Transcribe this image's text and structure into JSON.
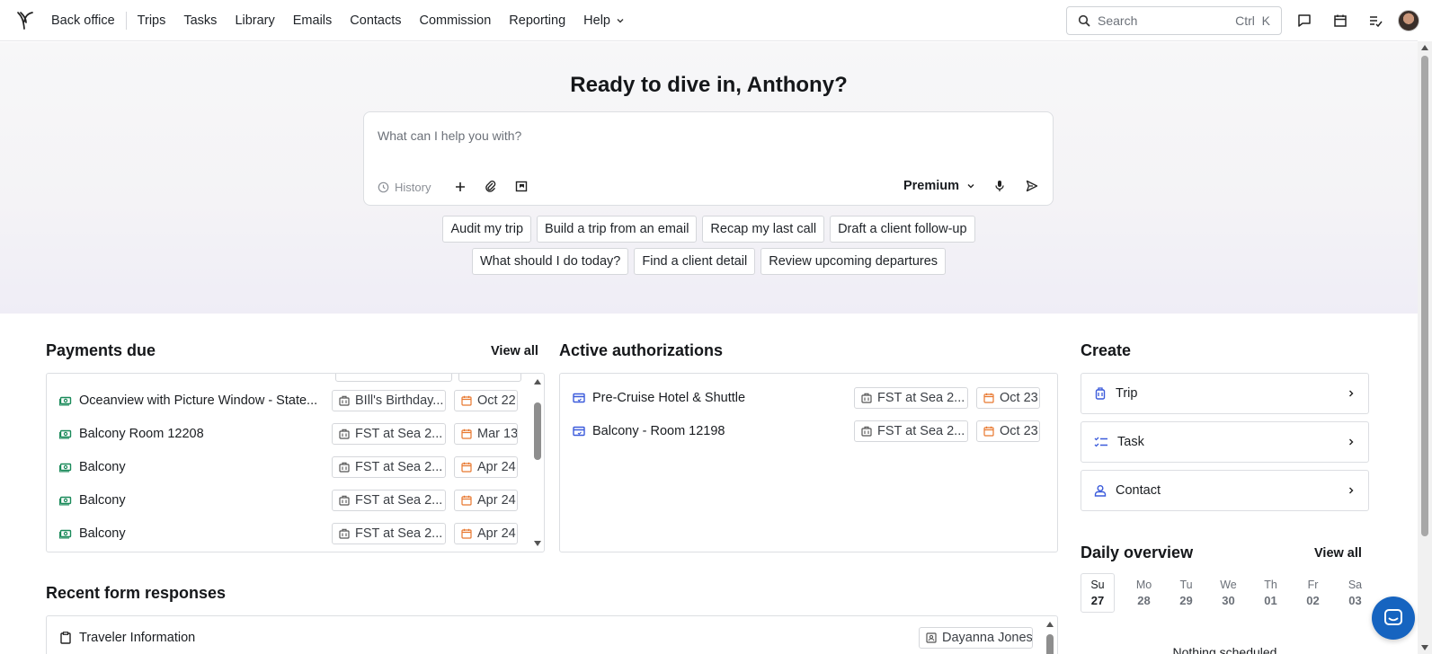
{
  "nav": {
    "items": [
      "Back office",
      "Trips",
      "Tasks",
      "Library",
      "Emails",
      "Contacts",
      "Commission",
      "Reporting",
      "Help"
    ],
    "search_placeholder": "Search",
    "search_shortcut": "Ctrl  K"
  },
  "hero": {
    "title": "Ready to dive in, Anthony?",
    "prompt_placeholder": "What can I help you with?",
    "history_label": "History",
    "model_label": "Premium",
    "chips_row1": [
      "Audit my trip",
      "Build a trip from an email",
      "Recap my last call",
      "Draft a client follow-up"
    ],
    "chips_row2": [
      "What should I do today?",
      "Find a client detail",
      "Review upcoming departures"
    ]
  },
  "payments": {
    "title": "Payments due",
    "view_all": "View all",
    "rows": [
      {
        "label": "Oceanview with Picture Window - State...",
        "trip": "BIll's Birthday...",
        "date": "Oct 22"
      },
      {
        "label": "Balcony Room 12208",
        "trip": "FST at Sea 2...",
        "date": "Mar 13"
      },
      {
        "label": "Balcony",
        "trip": "FST at Sea 2...",
        "date": "Apr 24"
      },
      {
        "label": "Balcony",
        "trip": "FST at Sea 2...",
        "date": "Apr 24"
      },
      {
        "label": "Balcony",
        "trip": "FST at Sea 2...",
        "date": "Apr 24"
      }
    ]
  },
  "authorizations": {
    "title": "Active authorizations",
    "rows": [
      {
        "label": "Pre-Cruise Hotel & Shuttle",
        "trip": "FST at Sea 2...",
        "date": "Oct 23"
      },
      {
        "label": "Balcony - Room 12198",
        "trip": "FST at Sea 2...",
        "date": "Oct 23"
      }
    ]
  },
  "create": {
    "title": "Create",
    "items": [
      "Trip",
      "Task",
      "Contact"
    ]
  },
  "daily": {
    "title": "Daily overview",
    "view_all": "View all",
    "days": [
      {
        "dw": "Su",
        "num": "27"
      },
      {
        "dw": "Mo",
        "num": "28"
      },
      {
        "dw": "Tu",
        "num": "29"
      },
      {
        "dw": "We",
        "num": "30"
      },
      {
        "dw": "Th",
        "num": "01"
      },
      {
        "dw": "Fr",
        "num": "02"
      },
      {
        "dw": "Sa",
        "num": "03"
      }
    ],
    "empty": "Nothing scheduled"
  },
  "forms": {
    "title": "Recent form responses",
    "rows": [
      {
        "label": "Traveler Information",
        "contact": "Dayanna Jones"
      }
    ]
  },
  "colors": {
    "payment_icon": "#1a8a5a",
    "auth_icon": "#3b5bdb",
    "date_icon": "#e8772e",
    "chat_bubble": "#1664c0"
  }
}
